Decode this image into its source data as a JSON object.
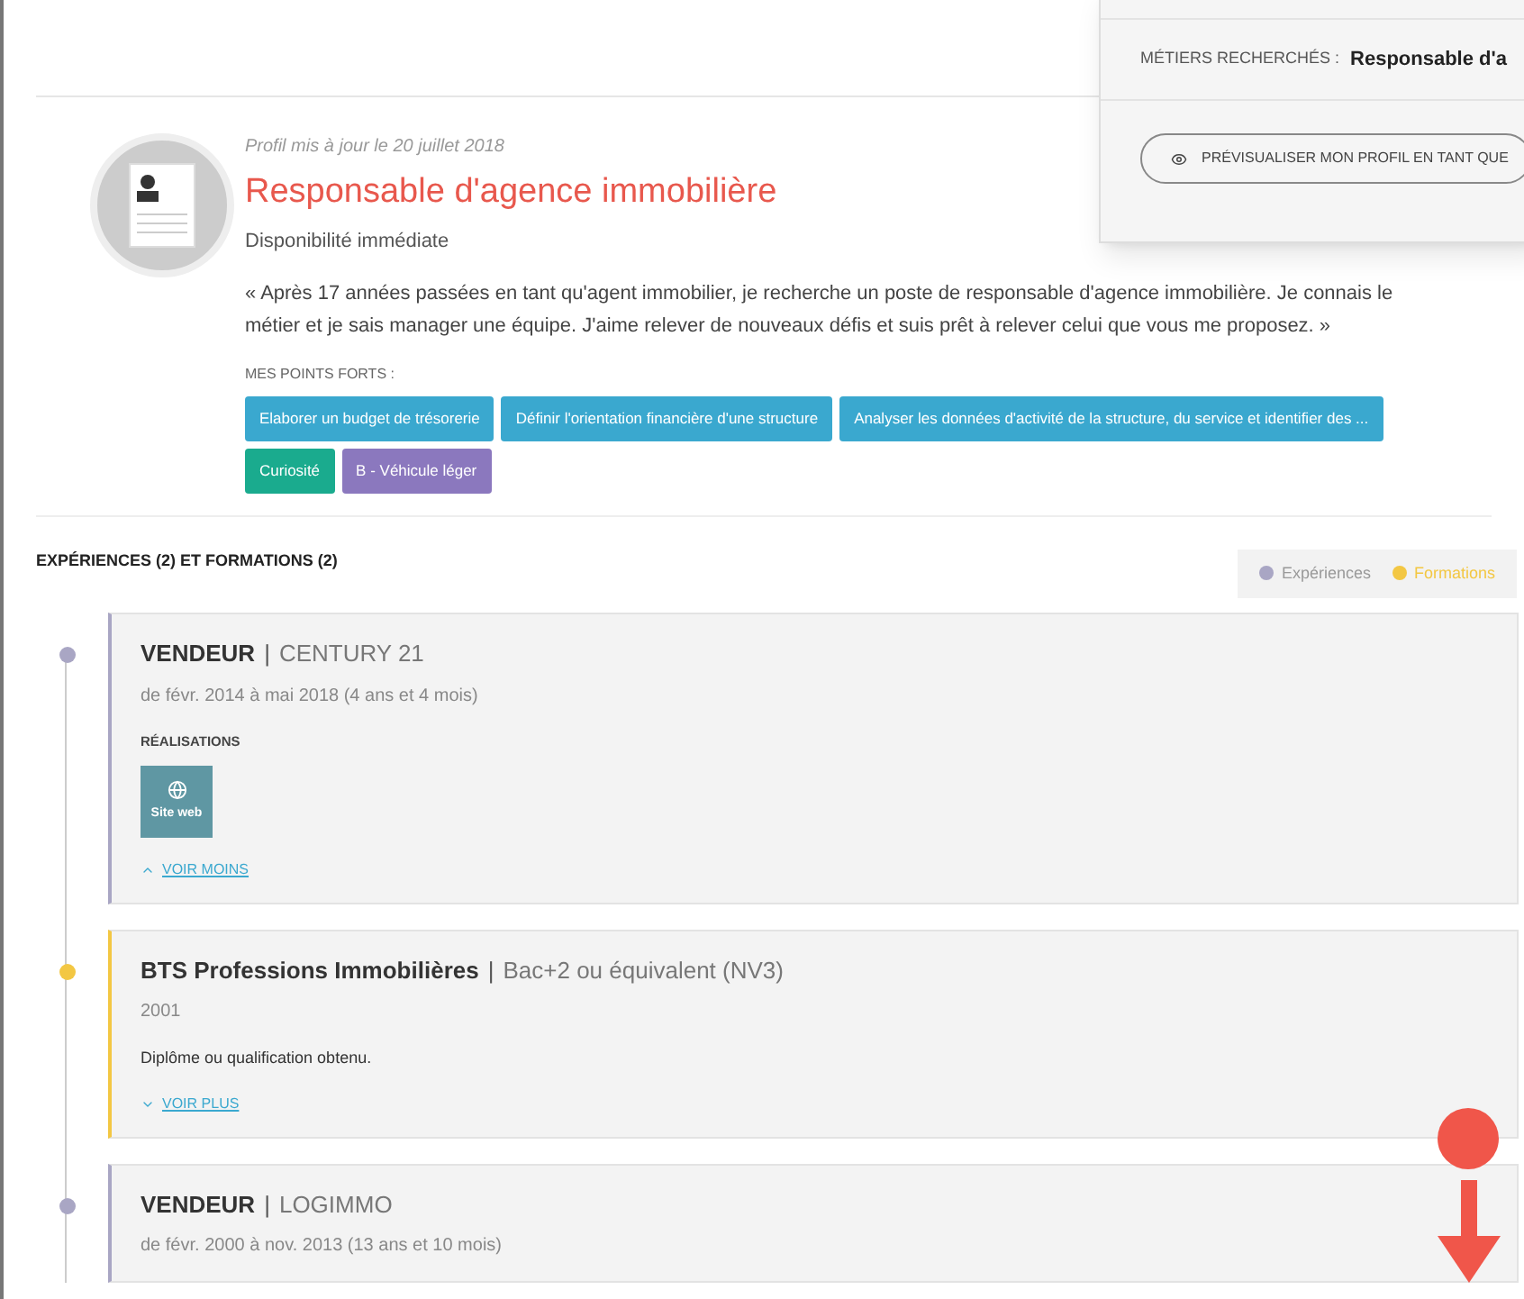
{
  "popup": {
    "label": "MÉTIERS RECHERCHÉS :",
    "value": "Responsable d'a",
    "button": "PRÉVISUALISER MON PROFIL EN TANT QUE"
  },
  "profile": {
    "updated": "Profil mis à jour le 20 juillet 2018",
    "title": "Responsable d'agence immobilière",
    "availability": "Disponibilité immédiate",
    "quote": "« Après 17 années passées en tant qu'agent immobilier, je recherche un poste de responsable d'agence immobilière. Je connais le métier et je sais manager une équipe. J'aime relever de nouveaux défis et suis prêt à relever celui que vous me proposez. »",
    "strengths_label": "MES POINTS FORTS :",
    "strengths": [
      {
        "label": "Elaborer un budget de trésorerie",
        "color": "#3aa8cf"
      },
      {
        "label": "Définir l'orientation financière d'une structure",
        "color": "#3aa8cf"
      },
      {
        "label": "Analyser les données d'activité de la structure, du service et identifier des ...",
        "color": "#3aa8cf"
      },
      {
        "label": "Curiosité",
        "color": "#1aab8e"
      },
      {
        "label": "B - Véhicule léger",
        "color": "#8b78be"
      }
    ]
  },
  "timeline": {
    "title": "EXPÉRIENCES (2) ET FORMATIONS (2)",
    "legend": [
      {
        "label": "Expériences",
        "color": "#a9a6c4"
      },
      {
        "label": "Formations",
        "color": "#f3c743"
      }
    ],
    "items": [
      {
        "kind": "experience",
        "color": "#a9a6c4",
        "title": "VENDEUR",
        "separator": "|",
        "subtitle": "CENTURY 21",
        "dates": "de févr. 2014 à mai 2018 (4 ans et 4 mois)",
        "section": "RÉALISATIONS",
        "tile": "Site web",
        "toggle": "VOIR MOINS",
        "expanded": true
      },
      {
        "kind": "formation",
        "color": "#f3c743",
        "title": "BTS Professions Immobilières",
        "separator": "|",
        "subtitle": "Bac+2 ou équivalent (NV3)",
        "dates": "2001",
        "note": "Diplôme ou qualification obtenu.",
        "toggle": "VOIR PLUS",
        "expanded": false
      },
      {
        "kind": "experience",
        "color": "#a9a6c4",
        "title": "VENDEUR",
        "separator": "|",
        "subtitle": "LOGIMMO",
        "dates": "de févr. 2000 à nov. 2013 (13 ans et 10 mois)"
      }
    ]
  }
}
